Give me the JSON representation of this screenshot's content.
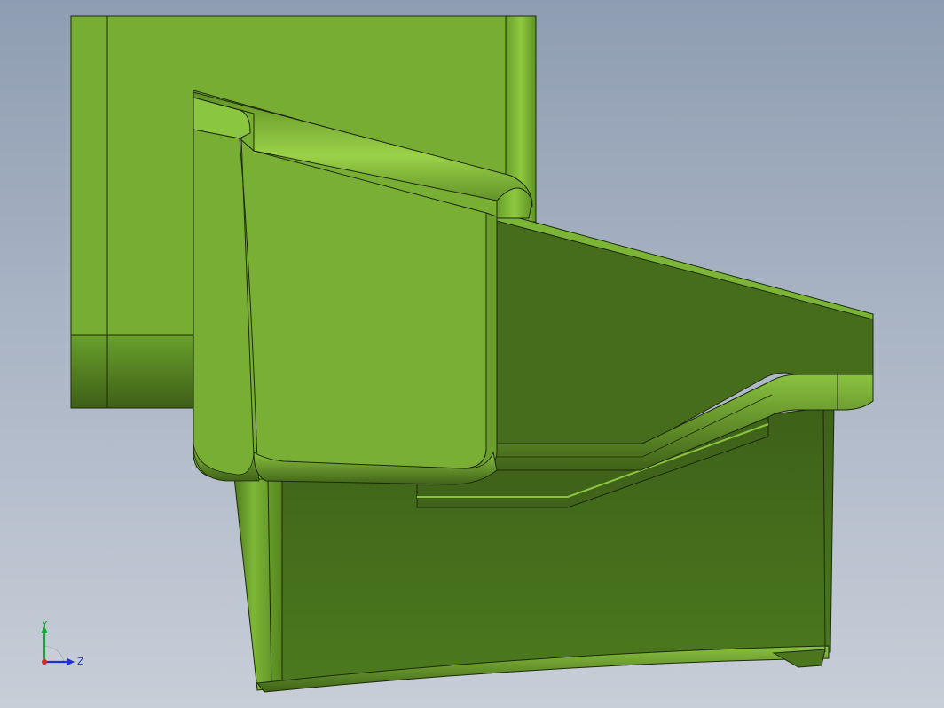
{
  "viewport": {
    "background_top": "#8f9db2",
    "background_bottom": "#c7ced8"
  },
  "model": {
    "color_light": "#77ad33",
    "color_mid": "#5f8f27",
    "color_dark": "#44691b",
    "edge_color": "#1c2a0a"
  },
  "triad": {
    "x_label": "Z",
    "y_label": "Y",
    "x_color": "#1d2fd6",
    "y_color": "#1aa33a",
    "origin_color": "#d02a2a"
  }
}
